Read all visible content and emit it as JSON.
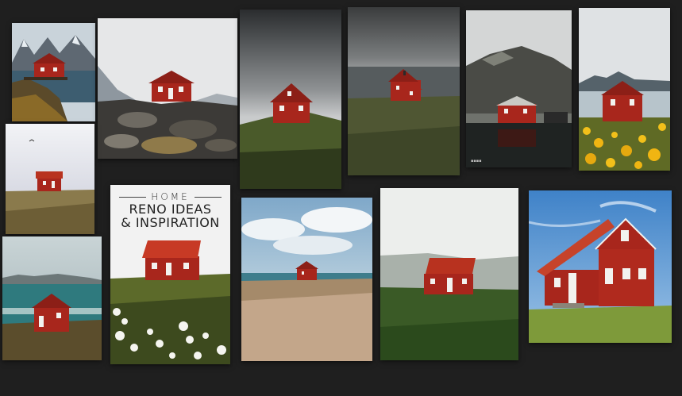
{
  "board": {
    "background": "#1f1f1f",
    "pin_caption": {
      "home": "HOME",
      "line1": "RENO IDEAS",
      "line2": "& INSPIRATION"
    },
    "photos": [
      {
        "id": "p1",
        "subject": "red cabin on rocky shore below mountains"
      },
      {
        "id": "p2",
        "subject": "red cabin on rocks under pale sky"
      },
      {
        "id": "p3",
        "subject": "red cabin on grassy hill under dark sky"
      },
      {
        "id": "p4",
        "subject": "red cabin by stormy sea"
      },
      {
        "id": "p5",
        "subject": "red boathouse under misty mountain"
      },
      {
        "id": "p6",
        "subject": "red cabin behind yellow flowers"
      },
      {
        "id": "p7",
        "subject": "red cabin on dry grass"
      },
      {
        "id": "p8",
        "subject": "red cabin by turquoise sea"
      },
      {
        "id": "p9",
        "subject": "home reno ideas pin with red cabin and white flowers"
      },
      {
        "id": "p10",
        "subject": "small red cabin beyond dry grass"
      },
      {
        "id": "p11",
        "subject": "red cabin on green hill in mist"
      },
      {
        "id": "p12",
        "subject": "red cabin with orange roof under blue sky"
      }
    ],
    "colors": {
      "cabin_red": "#a8261c",
      "roof_red": "#b8321f",
      "trim_white": "#f2f2ef"
    }
  }
}
